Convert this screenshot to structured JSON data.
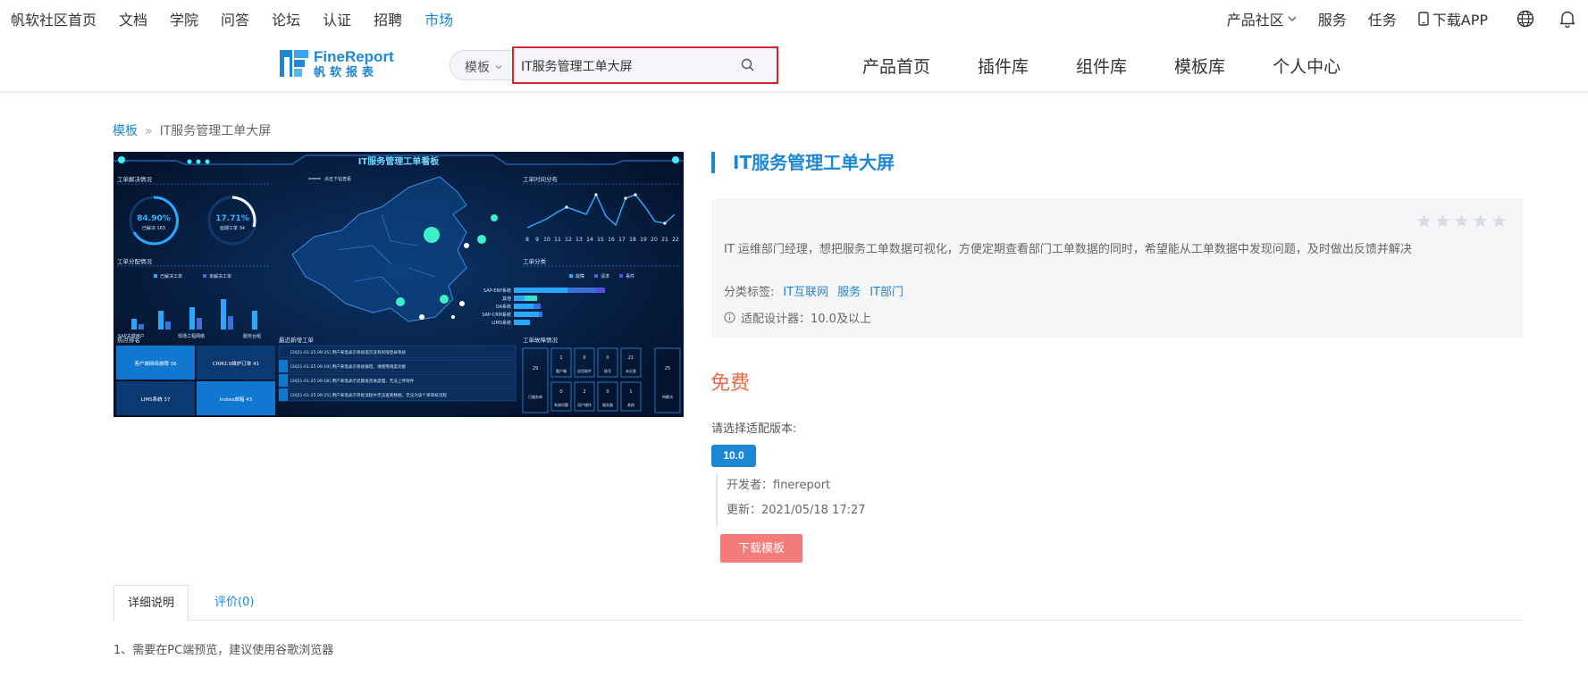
{
  "topnav": {
    "items": [
      "帆软社区首页",
      "文档",
      "学院",
      "问答",
      "论坛",
      "认证",
      "招聘",
      "市场"
    ],
    "right": {
      "product_community": "产品社区",
      "service": "服务",
      "tasks": "任务",
      "download_app": "下载APP"
    }
  },
  "header": {
    "logo_en": "FineReport",
    "logo_cn": "帆软报表",
    "search_category": "模板",
    "search_value": "IT服务管理工单大屏",
    "nav": [
      "产品首页",
      "插件库",
      "组件库",
      "模板库",
      "个人中心"
    ]
  },
  "breadcrumb": {
    "root": "模板",
    "sep": "»",
    "current": "IT服务管理工单大屏"
  },
  "preview": {
    "title": "IT服务管理工单看板",
    "panels": {
      "resolve": "工单解决情况",
      "distribution": "工单分配情况",
      "hotspot": "热点排名",
      "recent": "最近新增工单",
      "timeline": "工单时间分布",
      "category": "工单分类",
      "fault": "工单故障情况"
    },
    "gauge1_value": "84.90%",
    "gauge1_label": "已解决 163",
    "gauge2_value": "17.71%",
    "gauge2_label": "延期工单 34",
    "map_hint": "点击下钻查看",
    "legend_resolved": "已解决工单",
    "legend_unresolved": "未解决工单",
    "bar_labels": [
      "SAP关键用户",
      "现场工程网络",
      "服务台组"
    ],
    "hour_ticks": [
      "8",
      "9",
      "10",
      "11",
      "12",
      "13",
      "14",
      "15",
      "16",
      "17",
      "18",
      "19",
      "20",
      "21",
      "22"
    ],
    "hbar_legend": [
      "故障",
      "请求",
      "事件"
    ],
    "hbar_labels": [
      "SAP-ERP系统",
      "其他",
      "OA系统",
      "SAP-CRM系统",
      "LIMS系统"
    ],
    "hotspot_cells": [
      "客户端网络故障 36",
      "CRM2.0维护订单 41",
      "LIMS系统 37",
      "lnotes邮箱 43"
    ],
    "recent_rows": [
      "[2021-01-25 09:35] 用户来电表示系统提示没有权限登录系统",
      "[2021-01-25 09:19] 用户来电表示系统报错，请使用调度功能",
      "[2021-01-25 09:18] 用户来电表示近期发货进度慢，无法上传附件",
      "[2021-01-25 09:25] 用户来电表示审批流程中无法查到数据，无法为该个单审核流程"
    ],
    "fault_cells": [
      "29",
      "1",
      "0",
      "0",
      "21",
      "25",
      "0",
      "2",
      "0",
      "1"
    ],
    "fault_labels": [
      "已服务单",
      "客户端",
      "应用软件",
      "账号",
      "未分类",
      "待解决",
      "系统问题",
      "用户操作",
      "服务器",
      "其他"
    ]
  },
  "detail": {
    "title": "IT服务管理工单大屏",
    "description": "IT 运维部门经理，想把服务工单数据可视化，方便定期查看部门工单数据的同时，希望能从工单数据中发现问题，及时做出反馈并解决",
    "tags_label": "分类标签:",
    "tags": [
      "IT互联网",
      "服务",
      "IT部门"
    ],
    "designer": "适配设计器：10.0及以上",
    "price": "免费",
    "version_label": "请选择适配版本:",
    "version": "10.0",
    "developer": "开发者：finereport",
    "updated": "更新：2021/05/18 17:27",
    "download_label": "下载模板"
  },
  "tabs": {
    "detail": "详细说明",
    "reviews": "评价(0)"
  },
  "note": "1、需要在PC端预览，建议使用谷歌浏览器",
  "colors": {
    "accent": "#1d87d6",
    "price": "#e8684a",
    "download": "#f57a7a",
    "search_highlight": "#d9272b"
  }
}
